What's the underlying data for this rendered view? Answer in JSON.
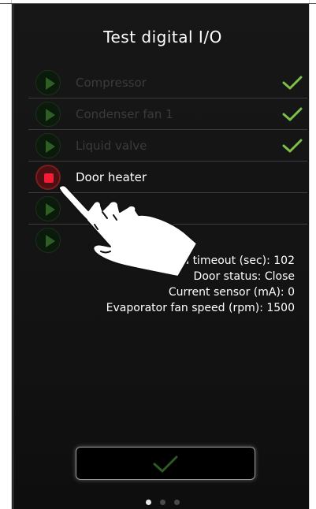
{
  "screen": {
    "title": "Test digital I/O"
  },
  "outputs": [
    {
      "label": "Compressor",
      "state": "idle",
      "checked": true
    },
    {
      "label": "Condenser fan 1",
      "state": "idle",
      "checked": true
    },
    {
      "label": "Liquid valve",
      "state": "idle",
      "checked": true
    },
    {
      "label": "Door heater",
      "state": "running",
      "checked": false
    },
    {
      "label": "",
      "state": "idle",
      "checked": false
    },
    {
      "label": "",
      "state": "idle",
      "checked": false
    }
  ],
  "info": {
    "load_timeout": "Load timeout (sec): 102",
    "door_status": "Door status: Close",
    "current_sensor": "Current sensor (mA): 0",
    "evap_fan_speed": "Evaporator fan speed (rpm): 1500"
  },
  "pagination": {
    "pages": 3,
    "current": 1
  },
  "colors": {
    "background": "#141414",
    "check_green": "#7cc04b",
    "stop_red": "#f21d35",
    "play_dim_green": "#2f5e24"
  },
  "icons": {
    "play": "play-icon",
    "stop": "stop-icon",
    "check": "check-icon",
    "confirm": "check-icon",
    "pointer": "hand-pointer-icon"
  }
}
